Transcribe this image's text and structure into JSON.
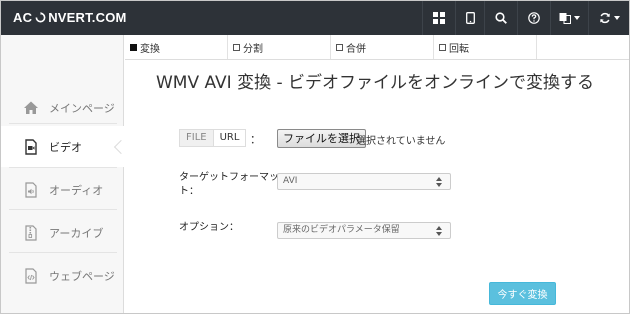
{
  "header": {
    "logo_left": "AC",
    "logo_right": "NVERT.COM",
    "buttons": [
      {
        "name": "grid-icon"
      },
      {
        "name": "tablet-icon"
      },
      {
        "name": "search-icon"
      },
      {
        "name": "help-icon"
      },
      {
        "name": "language-icon"
      },
      {
        "name": "refresh-icon"
      }
    ]
  },
  "sidebar": {
    "items": [
      {
        "label": "メインページ",
        "icon": "home-icon"
      },
      {
        "label": "ビデオ",
        "icon": "video-file-icon",
        "active": true
      },
      {
        "label": "オーディオ",
        "icon": "audio-file-icon"
      },
      {
        "label": "アーカイブ",
        "icon": "archive-file-icon"
      },
      {
        "label": "ウェブページ",
        "icon": "code-file-icon"
      }
    ]
  },
  "tabs": [
    {
      "label": "変換",
      "active": true
    },
    {
      "label": "分割",
      "active": false
    },
    {
      "label": "合併",
      "active": false
    },
    {
      "label": "回転",
      "active": false
    }
  ],
  "main": {
    "title": "WMV AVI 変換 - ビデオファイルをオンラインで変換する",
    "source_file": "FILE",
    "source_url": "URL",
    "source_colon": "：",
    "file_button": "ファイルを選択",
    "file_status": "選択されていません",
    "target_label_line1": "ターゲットフォーマッ",
    "target_label_line2": "ト：",
    "target_value": "AVI",
    "options_label": "オプション：",
    "options_value": "原来のビデオパラメータ保留",
    "convert_button": "今すぐ変換"
  },
  "colors": {
    "header_bg": "#2d3238",
    "accent_button": "#5bc0de"
  }
}
